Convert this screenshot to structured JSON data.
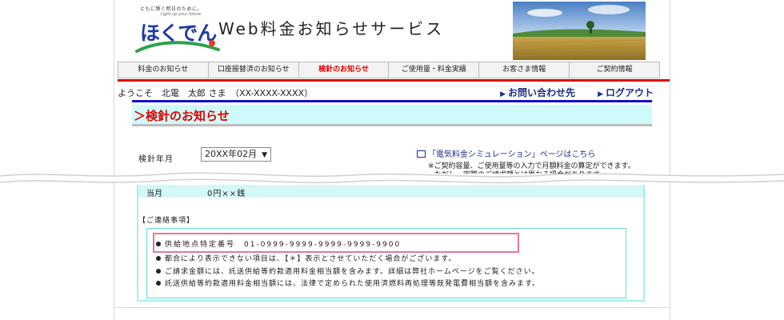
{
  "header": {
    "tagline": "ともに輝く明日のために。",
    "tagline_en": "Light up your future.",
    "logo": "ほくでん",
    "service_title": "Web料金お知らせサービス"
  },
  "nav": {
    "items": [
      {
        "label": "料金のお知らせ",
        "active": false
      },
      {
        "label": "口座振替済のお知らせ",
        "active": false
      },
      {
        "label": "検針のお知らせ",
        "active": true
      },
      {
        "label": "ご使用量・料金実績",
        "active": false
      },
      {
        "label": "お客さま情報",
        "active": false
      },
      {
        "label": "ご契約情報",
        "active": false
      }
    ]
  },
  "user": {
    "welcome": "ようこそ　北電　太郎 さま　（XX-XXXX-XXXX）"
  },
  "links": {
    "contact": "お問い合わせ先",
    "logout": "ログアウト"
  },
  "page": {
    "heading": "＞検針のお知らせ"
  },
  "filter": {
    "month_label": "検針年月",
    "month_value": "20XX年02月"
  },
  "simulation": {
    "link": "「電気料金シミュレーション」ページはこちら",
    "note1": "※ご契約容量、ご使用量等の入力で月額料金の算定ができます。",
    "note2": "ただし、実際のご請求額とは異なる場合があります。"
  },
  "table": {
    "row_label": "当月",
    "row_value": "0円××銭"
  },
  "contact": {
    "label": "【ご連絡事項】",
    "items": [
      "供給地点特定番号　01-0999-9999-9999-9999-9900",
      "都合により表示できない項目は、【＊】表示とさせていただく場合がございます。",
      "ご請求金額には、託送供給等約款適用料金相当額を含みます。詳細は弊社ホームページをご覧ください。",
      "託送供給等約款適用料金相当額には、法律で定められた使用済燃料再処理等既発電費相当額を含みます。"
    ]
  },
  "colors": {
    "accent_red": "#e00000",
    "nav_blue": "#1b2d8a",
    "heading_bg": "#cffafa",
    "highlight_pink": "#e37a9a"
  }
}
